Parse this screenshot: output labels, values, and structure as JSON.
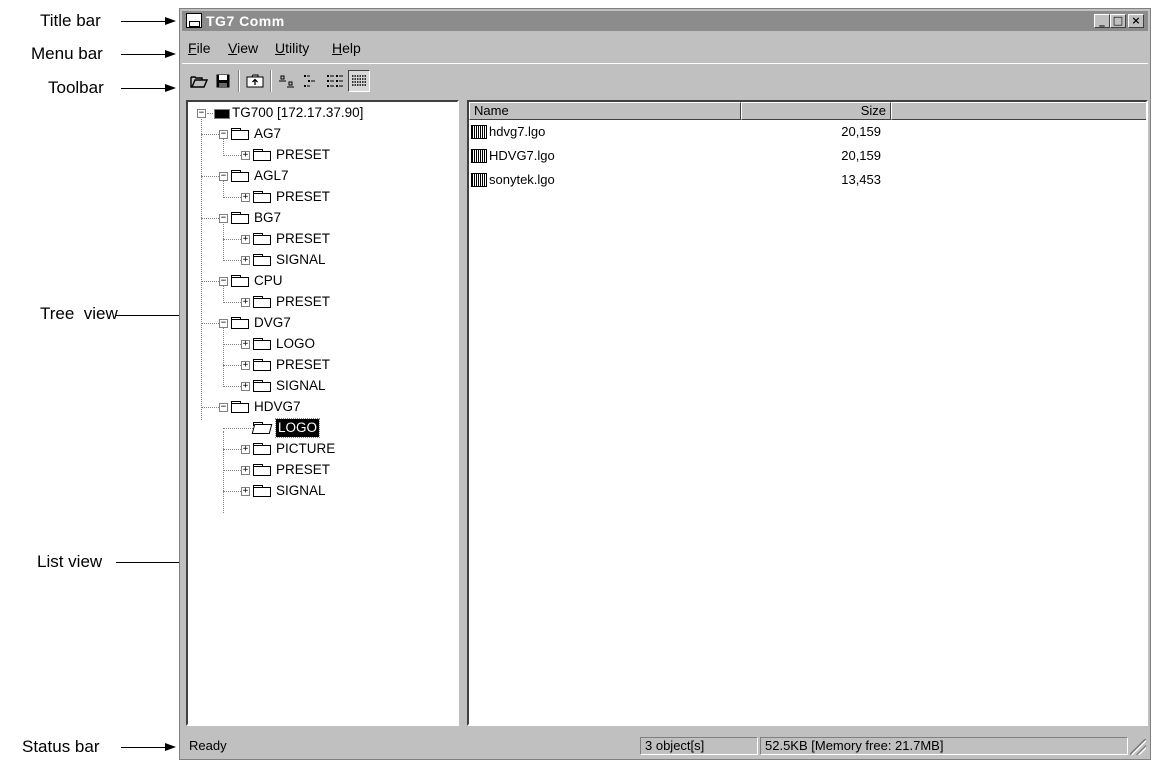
{
  "annotations": {
    "title_bar": "Title bar",
    "menu_bar": "Menu bar",
    "toolbar": "Toolbar",
    "tree_view": "Tree  view",
    "list_view": "List view",
    "status_bar": "Status bar"
  },
  "window": {
    "title": "TG7 Comm",
    "icon": "app-icon",
    "controls": [
      "minimize-icon",
      "maximize-icon",
      "close-icon"
    ]
  },
  "menu": {
    "items": [
      {
        "label": "File",
        "mnemonic": "F",
        "rest": "ile"
      },
      {
        "label": "View",
        "mnemonic": "V",
        "rest": "iew"
      },
      {
        "label": "Utility",
        "mnemonic": "U",
        "rest": "tility"
      },
      {
        "label": "Help",
        "mnemonic": "H",
        "rest": "elp"
      }
    ]
  },
  "toolbar": {
    "buttons": [
      "open-icon",
      "save-icon",
      "up-folder-icon",
      "large-icons-icon",
      "small-icons-icon",
      "list-icon",
      "details-icon"
    ],
    "pressed": "details-icon"
  },
  "tree": {
    "root": "TG700 [172.17.37.90]",
    "nodes": [
      {
        "label": "AG7",
        "children": [
          "PRESET"
        ]
      },
      {
        "label": "AGL7",
        "children": [
          "PRESET"
        ]
      },
      {
        "label": "BG7",
        "children": [
          "PRESET",
          "SIGNAL"
        ]
      },
      {
        "label": "CPU",
        "children": [
          "PRESET"
        ]
      },
      {
        "label": "DVG7",
        "children": [
          "LOGO",
          "PRESET",
          "SIGNAL"
        ]
      },
      {
        "label": "HDVG7",
        "children": [
          "LOGO",
          "PICTURE",
          "PRESET",
          "SIGNAL"
        ]
      }
    ],
    "selected": "LOGO"
  },
  "list": {
    "columns": [
      "Name",
      "Size"
    ],
    "rows": [
      {
        "name": "hdvg7.lgo",
        "size": "20,159"
      },
      {
        "name": "HDVG7.lgo",
        "size": "20,159"
      },
      {
        "name": "sonytek.lgo",
        "size": "13,453"
      }
    ]
  },
  "status": {
    "text": "Ready",
    "objects": "3 object[s]",
    "memory": "52.5KB [Memory free: 21.7MB]"
  }
}
